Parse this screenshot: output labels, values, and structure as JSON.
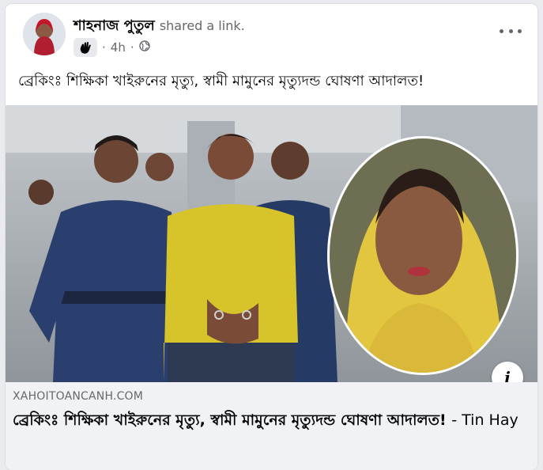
{
  "post": {
    "author": "শাহনাজ পুতুল",
    "action": "shared a link.",
    "time": "4h",
    "privacy_icon": "globe-icon",
    "badge_icon": "waving-hand-icon",
    "menu_icon": "more-horizontal-icon",
    "text": "ব্রেকিংঃ শিক্ষিকা খাইরুনের মৃত্যু, স্বামী মামুনের মৃত্যুদন্ড ঘোষণা আদালত!"
  },
  "link": {
    "domain": "XAHOITOANCANH.COM",
    "title": "ব্রেকিংঃ শিক্ষিকা খাইরুনের মৃত্যু, স্বামী মামুনের মৃত্যুদন্ড ঘোষণা আদালত!",
    "site_suffix": "- Tin Hay",
    "info_label": "i",
    "info_icon": "info-icon"
  },
  "colors": {
    "card_bg": "#ffffff",
    "footer_bg": "#f0f2f5",
    "text_primary": "#050505",
    "text_secondary": "#65676b",
    "police_uniform": "#2b3f6e",
    "yellow_shirt": "#d7c42a",
    "scarf_yellow": "#e3c640"
  }
}
